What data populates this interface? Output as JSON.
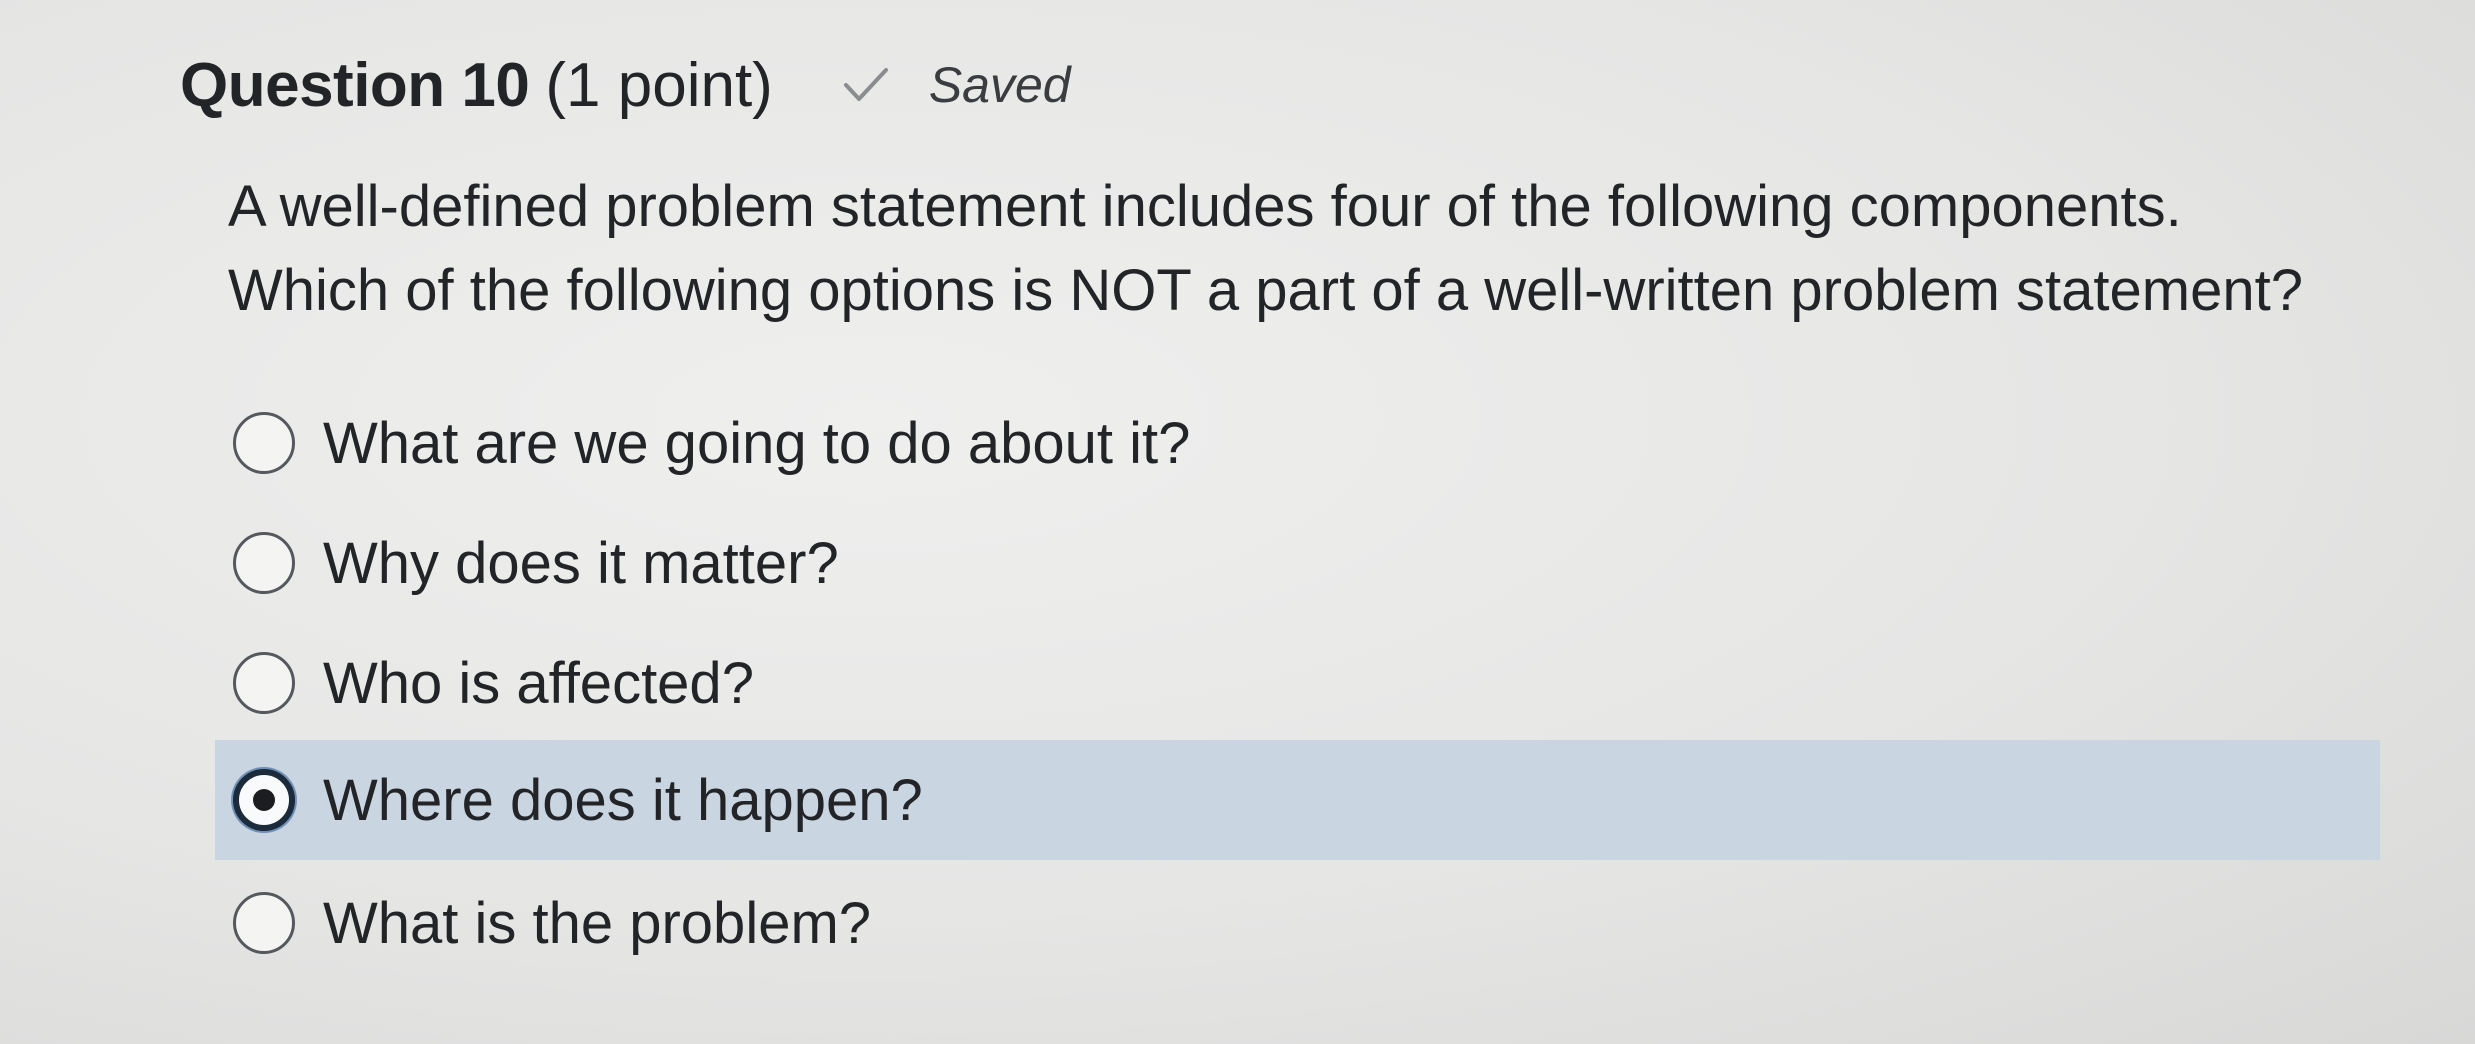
{
  "question": {
    "title": "Question 10",
    "points": "(1 point)",
    "status_icon": "checkmark-icon",
    "status": "Saved",
    "prompt_lines": [
      "A well-defined problem statement includes four of the following components.",
      "Which of the following options is NOT a part of a well-written problem statement?"
    ],
    "options": [
      {
        "label": "What are we going to do about it?",
        "selected": false
      },
      {
        "label": "Why does it matter?",
        "selected": false
      },
      {
        "label": "Who is affected?",
        "selected": false
      },
      {
        "label": "Where does it happen?",
        "selected": true
      },
      {
        "label": "What is the problem?",
        "selected": false
      }
    ]
  },
  "colors": {
    "selected_row": "#c9d5e0",
    "text": "#222428"
  }
}
